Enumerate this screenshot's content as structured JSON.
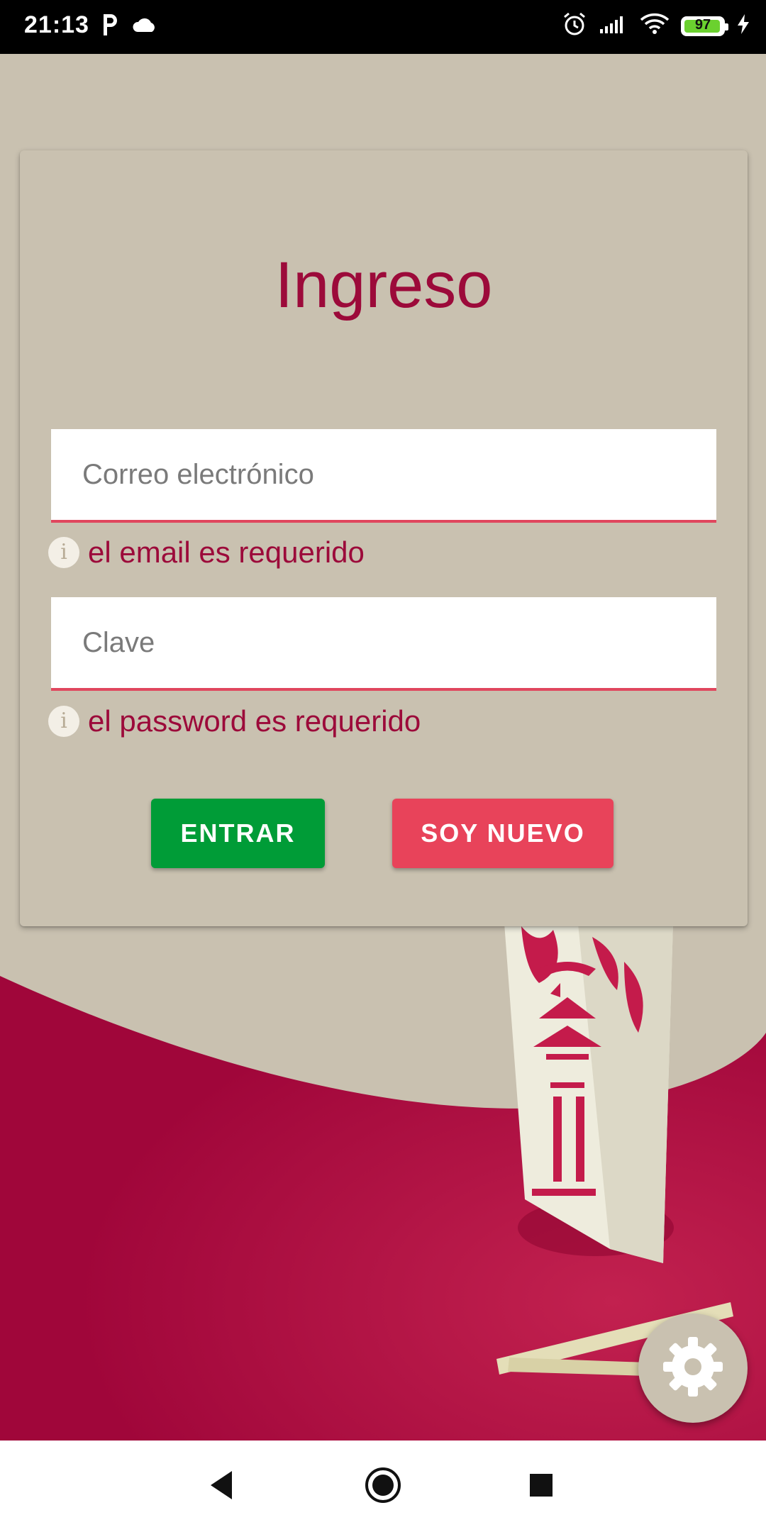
{
  "status_bar": {
    "time": "21:13",
    "battery_level": "97",
    "battery_fill_fraction": 0.97,
    "left_icons": [
      "parking-icon",
      "cloud-icon"
    ],
    "right_icons": [
      "alarm-icon",
      "signal-icon",
      "wifi-icon",
      "battery-icon",
      "charging-icon"
    ]
  },
  "login": {
    "title": "Ingreso",
    "email": {
      "placeholder": "Correo electrónico",
      "value": "",
      "error": "el email es requerido"
    },
    "password": {
      "placeholder": "Clave",
      "value": "",
      "error": "el password es requerido"
    },
    "error_icon_glyph": "i",
    "buttons": {
      "enter_label": "ENTRAR",
      "new_label": "SOY NUEVO"
    }
  },
  "fab": {
    "icon": "gear-icon"
  },
  "nav_bar": {
    "icons": [
      "back-icon",
      "home-icon",
      "recents-icon"
    ]
  },
  "colors": {
    "background": "#c9c1b0",
    "accent": "#9c0a3a",
    "enter_button": "#009c37",
    "new_button": "#e8435a",
    "field_underline": "#e0475e"
  }
}
